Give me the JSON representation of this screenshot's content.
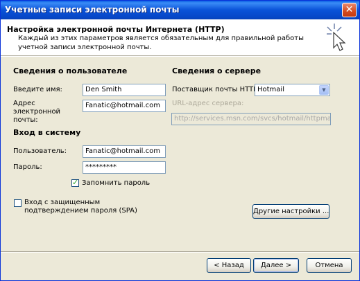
{
  "window": {
    "title": "Учетные записи электронной почты"
  },
  "header": {
    "title": "Настройка электронной почты Интернета (HTTP)",
    "description": "Каждый из этих параметров является обязательным для правильной работы учетной записи электронной почты."
  },
  "user_info": {
    "heading": "Сведения о пользователе",
    "name_label": "Введите имя:",
    "name_value": "Den Smith",
    "email_label": "Адрес электронной почты:",
    "email_value": "Fanatic@hotmail.com"
  },
  "login": {
    "heading": "Вход в систему",
    "user_label": "Пользователь:",
    "user_value": "Fanatic@hotmail.com",
    "password_label": "Пароль:",
    "password_value": "*********",
    "remember_label": "Запомнить пароль",
    "remember_checked": true,
    "spa_label_line1": "Вход с защищенным",
    "spa_label_line2": "подтверждением пароля (SPA)",
    "spa_checked": false
  },
  "server_info": {
    "heading": "Сведения о сервере",
    "provider_label": "Поставщик почты HTTP:",
    "provider_value": "Hotmail",
    "url_label": "URL-адрес сервера:",
    "url_value": "http://services.msn.com/svcs/hotmail/httpmail.asp"
  },
  "buttons": {
    "more_settings": "Другие настройки ...",
    "back": "< Назад",
    "next": "Далее >",
    "cancel": "Отмена"
  },
  "colors": {
    "titlebar": "#0a52d8",
    "dialog_bg": "#ece9d8",
    "input_border": "#7f9db9"
  }
}
